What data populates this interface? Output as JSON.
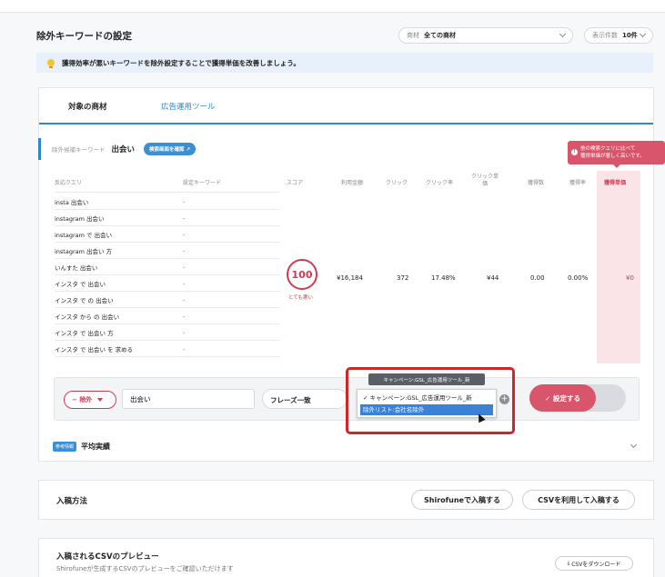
{
  "header": {
    "title": "除外キーワードの設定",
    "material_filter": {
      "label": "商材",
      "value": "全ての商材"
    },
    "display_count": {
      "label": "表示件数",
      "value": "10件"
    }
  },
  "notice": {
    "text": "獲得効率が悪いキーワードを除外設定することで獲得単価を改善しましょう。"
  },
  "tabs": [
    {
      "label": "対象の商材"
    },
    {
      "label": "広告運用ツール"
    }
  ],
  "keyword": {
    "label": "除外候補キーワード",
    "value": "出会い",
    "search_screen_button": "検索画面を確認"
  },
  "tooltip": {
    "line1": "他の検索クエリに比べて",
    "line2": "獲得単価が著しく高いです。"
  },
  "table": {
    "headers": {
      "query": "反応クエリ",
      "set_keyword": "設定キーワード",
      "score": "スコア",
      "cost": "利用金額",
      "clicks": "クリック",
      "ctr": "クリック率",
      "cpc_line1": "クリック単",
      "cpc_line2": "価",
      "conversions": "獲得数",
      "cvr": "獲得率",
      "cpa": "獲得単価"
    },
    "rows": [
      {
        "query": "insta 出会い",
        "keyword": "-"
      },
      {
        "query": "instagram 出会い",
        "keyword": "-"
      },
      {
        "query": "instagram で 出会い",
        "keyword": "-"
      },
      {
        "query": "instagram 出会い 方",
        "keyword": "-"
      },
      {
        "query": "いんすた 出会い",
        "keyword": "-"
      },
      {
        "query": "インスタ で 出会い",
        "keyword": "-"
      },
      {
        "query": "インスタ で の 出会い",
        "keyword": "-"
      },
      {
        "query": "インスタ から の 出会い",
        "keyword": "-"
      },
      {
        "query": "インスタ で 出会い 方",
        "keyword": "-"
      },
      {
        "query": "インスタ で 出会い を 求める",
        "keyword": "-"
      }
    ],
    "score": {
      "value": "100",
      "label": "とても悪い"
    },
    "metrics": {
      "cost": "¥16,184",
      "clicks": "372",
      "ctr": "17.48%",
      "cpc": "¥44",
      "conversions": "0.00",
      "cvr": "0.00%",
      "cpa": "¥0"
    }
  },
  "action_bar": {
    "exclude_label": "除外",
    "keyword_input_value": "出会い",
    "match_type": "フレーズ一致",
    "campaign_tag": "キャンペーン:GSL_広告運用ツール_新",
    "options": [
      {
        "label": "キャンペーン:GSL_広告運用ツール_新",
        "check": "✓"
      },
      {
        "label": "除外リスト:会社名除外",
        "check": ""
      }
    ],
    "set_button": "設定する"
  },
  "reference": {
    "tag": "参考情報",
    "label": "平均実績"
  },
  "submission": {
    "title": "入稿方法",
    "shirofune_button": "Shirofuneで入稿する",
    "csv_button": "CSVを利用して入稿する"
  },
  "csv_preview": {
    "title": "入稿されるCSVのプレビュー",
    "subtitle": "Shirofuneが生成するCSVのプレビューをご確認いただけます",
    "download_button": "CSVをダウンロード"
  },
  "colors": {
    "accent_blue": "#2f86c8",
    "alert_red": "#cf3b51",
    "pink_button": "#d9556b",
    "highlight_frame": "#d2252a"
  }
}
